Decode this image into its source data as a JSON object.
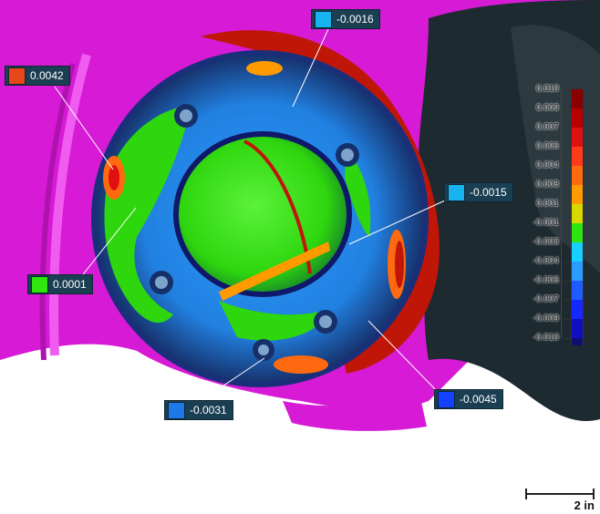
{
  "colors": {
    "background": "#ffffff",
    "out_of_range": "#d61ad6",
    "callout_bg": "#1b3f52"
  },
  "callouts": [
    {
      "id": "c1",
      "value": "0.0042",
      "color": "#e8471a"
    },
    {
      "id": "c2",
      "value": "-0.0016",
      "color": "#18b4f0"
    },
    {
      "id": "c3",
      "value": "-0.0015",
      "color": "#18b4f0"
    },
    {
      "id": "c4",
      "value": "0.0001",
      "color": "#2ee60e"
    },
    {
      "id": "c5",
      "value": "-0.0031",
      "color": "#1e78e8"
    },
    {
      "id": "c6",
      "value": "-0.0045",
      "color": "#1440ff"
    }
  ],
  "legend": {
    "labels": [
      "0.010",
      "0.009",
      "0.007",
      "0.006",
      "0.004",
      "0.003",
      "0.001",
      "-0.001",
      "-0.003",
      "-0.004",
      "-0.006",
      "-0.007",
      "-0.009",
      "-0.010"
    ],
    "band_colors": [
      "#8a0000",
      "#b80000",
      "#e01010",
      "#ff3a18",
      "#ff6a10",
      "#ff9a00",
      "#d8d800",
      "#2ee60e",
      "#18d0ff",
      "#2a9cff",
      "#1e5cff",
      "#1428ff",
      "#1010c0",
      "#101070"
    ]
  },
  "scale_bar": {
    "label": "2 in"
  }
}
